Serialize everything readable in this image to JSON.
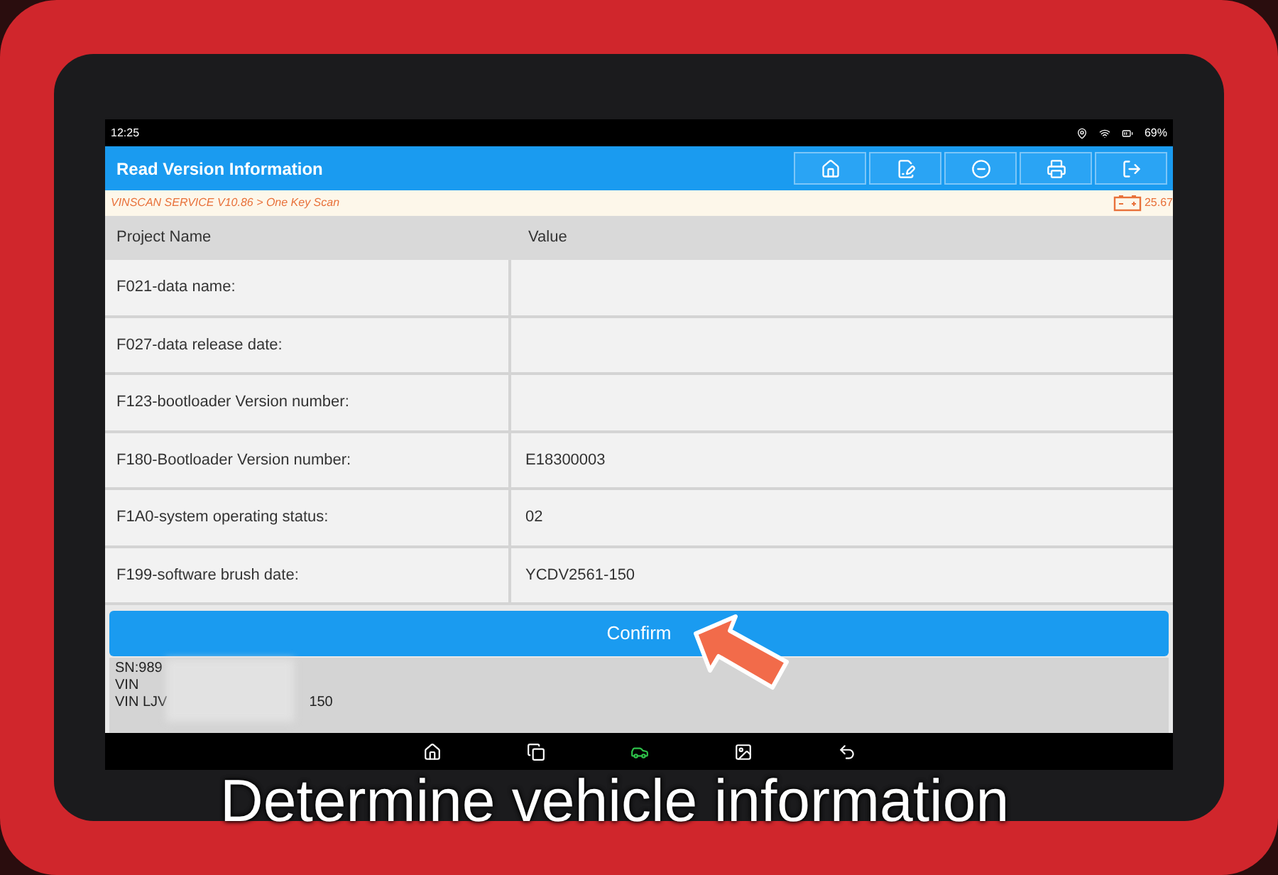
{
  "status_bar": {
    "time": "12:25",
    "battery": "69%"
  },
  "title": "Read Version Information",
  "breadcrumb": "VINSCAN SERVICE V10.86 > One Key Scan",
  "voltage": "25.67",
  "table": {
    "columns": [
      "Project Name",
      "Value"
    ],
    "rows": [
      {
        "name": "F021-data name:"
      },
      {
        "name": "F027-data release date:"
      },
      {
        "name": "F123-bootloader Version number:"
      },
      {
        "name": "F180-Bootloader Version number:",
        "value": "E18300003"
      },
      {
        "name": "F1A0-system operating status:",
        "value": "02"
      },
      {
        "name": "F199-software brush date:",
        "value": "YCDV2561-150"
      }
    ]
  },
  "confirm_button": "Confirm",
  "info_lines": [
    {
      "text": "SN:989"
    },
    {
      "text": "VIN"
    },
    {
      "text": "VIN LJV",
      "tail": "150"
    }
  ],
  "caption": "Determine vehicle information"
}
